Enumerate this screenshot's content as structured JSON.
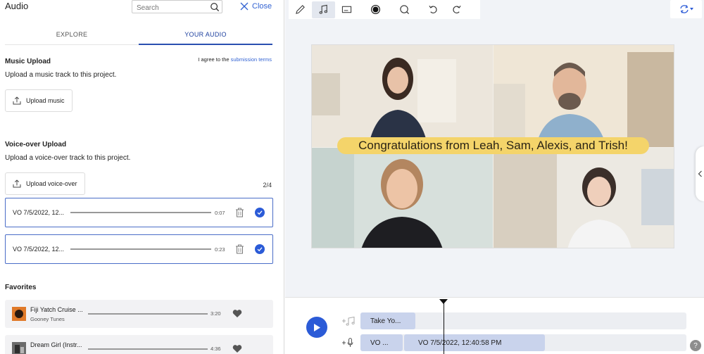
{
  "panel": {
    "title": "Audio",
    "search_placeholder": "Search",
    "close_label": "Close"
  },
  "tabs": [
    {
      "label": "EXPLORE",
      "active": false
    },
    {
      "label": "YOUR AUDIO",
      "active": true
    }
  ],
  "terms": {
    "prefix": "I agree to the",
    "link": "submission terms"
  },
  "music_upload": {
    "heading": "Music Upload",
    "description": "Upload a music track to this project.",
    "button": "Upload music"
  },
  "voiceover_upload": {
    "heading": "Voice-over Upload",
    "description": "Upload a voice-over track to this project.",
    "button": "Upload voice-over",
    "count": "2/4",
    "items": [
      {
        "name": "VO 7/5/2022, 12...",
        "duration": "0:07"
      },
      {
        "name": "VO 7/5/2022, 12...",
        "duration": "0:23"
      }
    ]
  },
  "favorites": {
    "heading": "Favorites",
    "items": [
      {
        "title": "Fiji Yatch Cruise ...",
        "artist": "Gooney Tunes",
        "duration": "3:20"
      },
      {
        "title": "Dream Girl (Instr...",
        "artist": "",
        "duration": "4:36"
      }
    ]
  },
  "toolbar": {
    "tools": [
      "pencil-icon",
      "music-note-icon",
      "caption-icon",
      "record-icon",
      "search-icon",
      "undo-icon",
      "redo-icon"
    ]
  },
  "video": {
    "caption": "Congratulations from Leah, Sam, Alexis, and Trish!"
  },
  "timeline": {
    "music_clip": "Take Yo...",
    "vo_clip_1": "VO ...",
    "vo_clip_2": "VO 7/5/2022, 12:40:58 PM",
    "help": "?"
  },
  "colors": {
    "accent": "#2b5bd7",
    "caption_band": "#f4d46a"
  }
}
